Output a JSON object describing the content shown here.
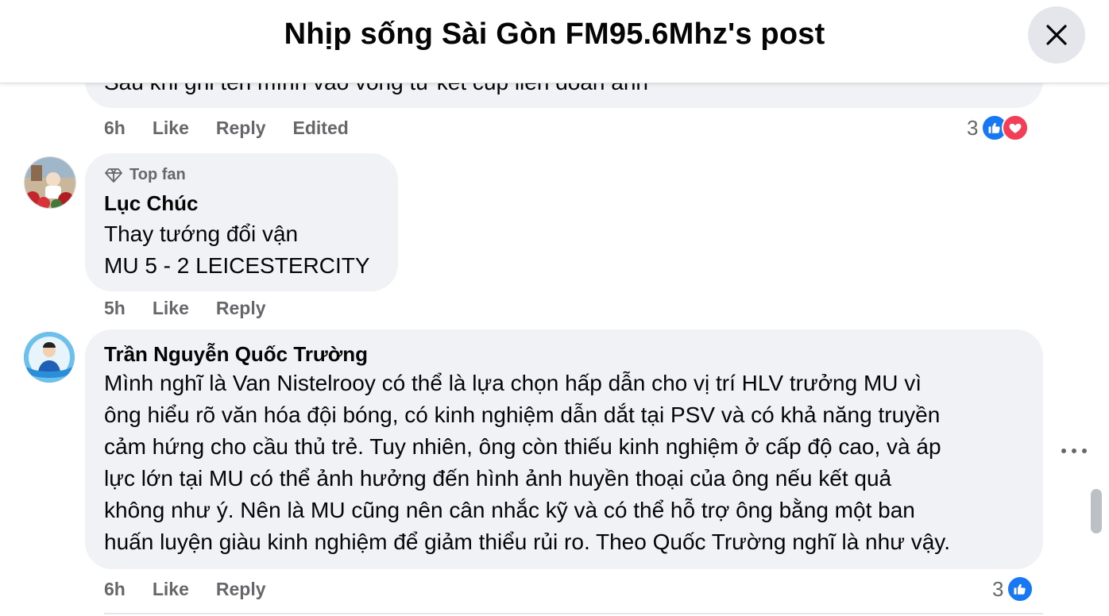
{
  "header": {
    "title": "Nhịp sống Sài Gòn FM95.6Mhz's post"
  },
  "comments": [
    {
      "text": "Sau khi ghi tên mình vào vòng tứ kết cúp liên đoàn anh",
      "time": "6h",
      "like": "Like",
      "reply": "Reply",
      "edited": "Edited",
      "reaction_count": "3",
      "reactions": [
        "like-icon",
        "love-icon"
      ]
    },
    {
      "badge": "Top fan",
      "author": "Lục Chúc",
      "lines": [
        "Thay tướng đổi vận",
        "MU 5 - 2 LEICESTERCITY"
      ],
      "time": "5h",
      "like": "Like",
      "reply": "Reply"
    },
    {
      "author": "Trần Nguyễn Quốc Trường",
      "lines": [
        "Mình nghĩ là Van Nistelrooy có thể là lựa chọn hấp dẫn cho vị trí HLV trưởng MU vì",
        "ông hiểu rõ văn hóa đội bóng, có kinh nghiệm dẫn dắt tại PSV và có khả năng truyền",
        "cảm hứng cho cầu thủ trẻ. Tuy nhiên, ông còn thiếu kinh nghiệm ở cấp độ cao, và áp",
        "lực lớn tại MU có thể ảnh hưởng đến hình ảnh huyền thoại của ông nếu kết quả",
        "không như ý. Nên là MU cũng nên cân nhắc kỹ và có thể hỗ trợ ông bằng một ban",
        "huấn luyện giàu kinh nghiệm để giảm thiểu rủi ro. Theo Quốc Trường nghĩ là như vậy."
      ],
      "time": "6h",
      "like": "Like",
      "reply": "Reply",
      "reaction_count": "3",
      "reactions": [
        "like-icon"
      ]
    }
  ],
  "colors": {
    "bubble": "#f0f2f5",
    "like_blue": "#1877f2",
    "love_red": "#f33e58",
    "meta_gray": "#65676b"
  }
}
